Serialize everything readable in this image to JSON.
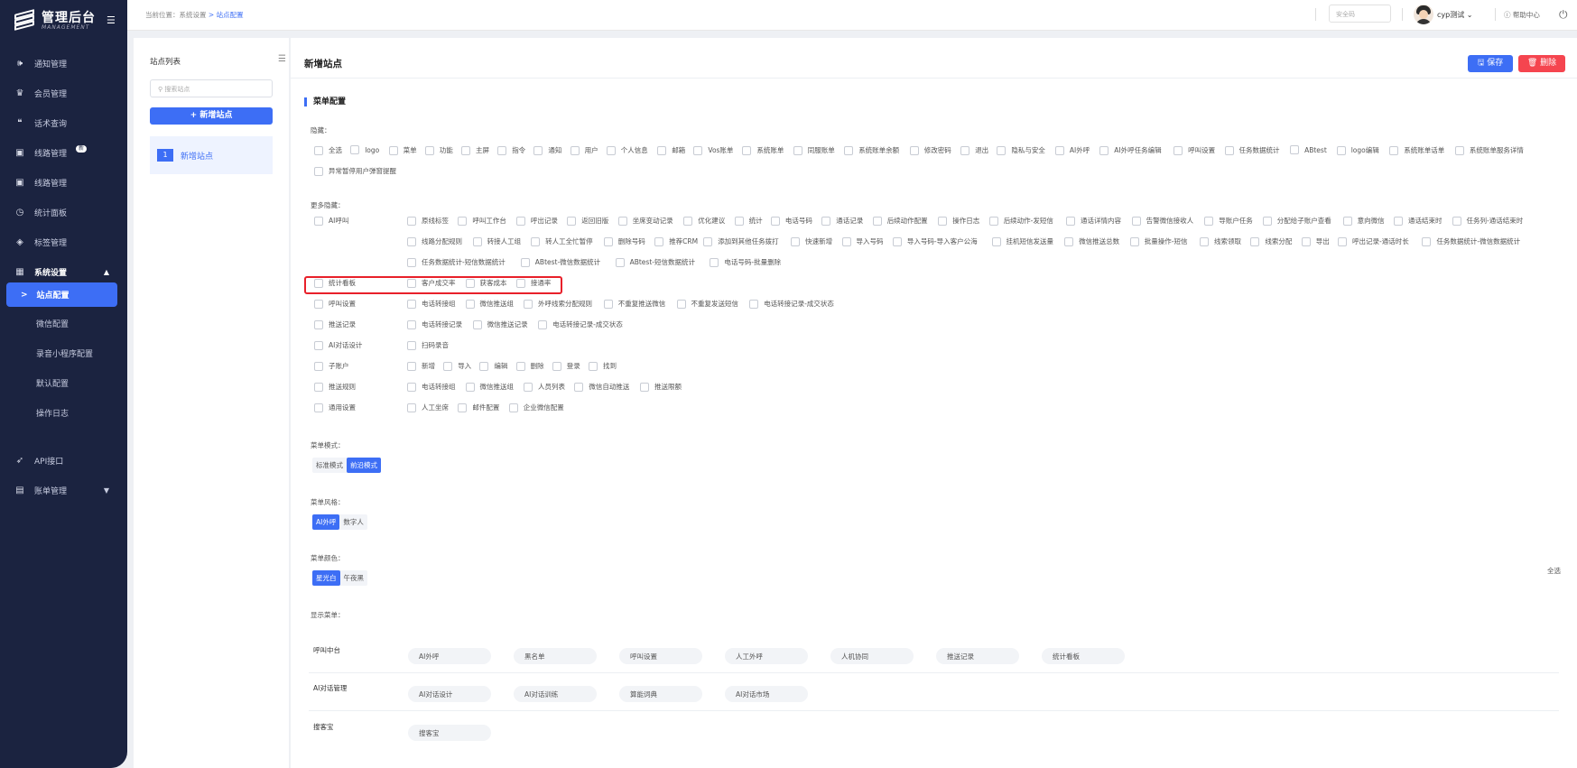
{
  "sidebar": {
    "logo_title": "管理后台",
    "logo_sub": "MANAGEMENT",
    "items": [
      {
        "label": "通知管理",
        "icon": "speaker-icon",
        "glyph": "🕪"
      },
      {
        "label": "会员管理",
        "icon": "crown-icon",
        "glyph": "♛"
      },
      {
        "label": "话术查询",
        "icon": "quote-icon",
        "glyph": "❝"
      },
      {
        "label": "线路管理",
        "icon": "image-icon",
        "glyph": "▣",
        "badge": "新"
      },
      {
        "label": "线路管理",
        "icon": "image-icon",
        "glyph": "▣"
      },
      {
        "label": "统计面板",
        "icon": "clock-icon",
        "glyph": "◷"
      },
      {
        "label": "标签管理",
        "icon": "tag-icon",
        "glyph": "◈"
      },
      {
        "label": "系统设置",
        "icon": "grid-icon",
        "glyph": "▦",
        "arrow": "▲"
      },
      {
        "label": "API接口",
        "icon": "rocket-icon",
        "glyph": "➶"
      },
      {
        "label": "账单管理",
        "icon": "book-icon",
        "glyph": "▤",
        "arrow": "▼"
      }
    ],
    "sub_items": [
      {
        "label": "站点配置",
        "glyph": ">"
      },
      {
        "label": "微信配置"
      },
      {
        "label": "录音小程序配置"
      },
      {
        "label": "默认配置"
      },
      {
        "label": "操作日志"
      }
    ]
  },
  "topbar": {
    "crumb_prefix": "当前位置：",
    "crumb_1": "系统设置",
    "crumb_sep": ">",
    "crumb_2": "站点配置",
    "security_placeholder": "安全码",
    "user": "cyp测试 ⌄",
    "help": "ⓘ 帮助中心",
    "power": "⏻"
  },
  "site_list": {
    "title": "站点列表",
    "search_placeholder": "搜索站点",
    "add_label": "+ 新增站点",
    "item_num": "1",
    "item_label": "新增站点"
  },
  "main": {
    "title": "新增站点",
    "save": "🖫 保存",
    "delete": "🗑 删除",
    "section": "菜单配置",
    "hide_label": "隐藏：",
    "hide_items": [
      "全选",
      "logo",
      "菜单",
      "功能",
      "主屏",
      "指令",
      "通知",
      "用户",
      "个人信息",
      "邮箱",
      "Vos账单",
      "系统账单",
      "同服账单",
      "系统账单余额",
      "修改密码",
      "退出",
      "隐私与安全",
      "AI外呼",
      "AI外呼任务编辑",
      "呼叫设置",
      "任务数据统计",
      "ABtest",
      "logo编辑",
      "系统账单话单",
      "系统账单服务详情",
      "异常暂停用户弹窗提醒"
    ],
    "more_label": "更多隐藏：",
    "more_rows": [
      {
        "name": "AI呼叫",
        "lines": [
          [
            "原线标签",
            "呼叫工作台",
            "呼出记录",
            "返回旧版",
            "坐席变动记录",
            "优化建议",
            "统计",
            "电话号码",
            "通话记录",
            "后续动作配置",
            "操作日志",
            "后续动作-发短信",
            "通话详情内容",
            "告警微信接收人",
            "导账户任务",
            "分配给子账户查看",
            "意向微信",
            "通话结束时",
            "任务列-通话结束时"
          ],
          [
            "线路分配规则",
            "转接人工组",
            "转人工全忙暂停",
            "删除号码",
            "推荐CRM",
            "添加到其他任务拨打",
            "快速新增",
            "导入号码",
            "导入号码-导入客户公海",
            "挂机短信发送量",
            "微信推送总数",
            "批量操作-短信",
            "线索领取",
            "线索分配",
            "导出",
            "呼出记录-通话时长",
            "任务数据统计-微信数据统计"
          ],
          [
            "任务数据统计-短信数据统计",
            "ABtest-微信数据统计",
            "ABtest-短信数据统计",
            "电话号码-批量删除"
          ]
        ]
      },
      {
        "name": "统计看板",
        "lines": [
          [
            "客户成交率",
            "获客成本",
            "接通率"
          ]
        ]
      },
      {
        "name": "呼叫设置",
        "lines": [
          [
            "电话转接组",
            "微信推送组",
            "外呼线索分配规则",
            "不重复推送微信",
            "不重复发送短信",
            "电话转接记录-成交状态"
          ]
        ]
      },
      {
        "name": "推送记录",
        "lines": [
          [
            "电话转接记录",
            "微信推送记录",
            "电话转接记录-成交状态"
          ]
        ]
      },
      {
        "name": "AI对话设计",
        "lines": [
          [
            "扫码录音"
          ]
        ]
      },
      {
        "name": "子账户",
        "lines": [
          [
            "新增",
            "导入",
            "编辑",
            "删除",
            "登录",
            "找到"
          ]
        ]
      },
      {
        "name": "推送规则",
        "lines": [
          [
            "电话转接组",
            "微信推送组",
            "人员列表",
            "微信自动推送",
            "推送限额"
          ]
        ]
      },
      {
        "name": "通用设置",
        "lines": [
          [
            "人工坐席",
            "邮件配置",
            "企业微信配置"
          ]
        ]
      }
    ],
    "mode_label": "菜单模式：",
    "mode_opts": [
      "标准模式",
      "前沿模式"
    ],
    "style_label": "菜单风格：",
    "style_opts": [
      "AI外呼",
      "数字人"
    ],
    "color_label": "菜单颜色：",
    "color_opts": [
      "星光白",
      "午夜黑"
    ],
    "show_label": "显示菜单：",
    "select_all": "全选",
    "show_rows": [
      {
        "name": "呼叫中台",
        "items": [
          "AI外呼",
          "黑名单",
          "呼叫设置",
          "人工外呼",
          "人机协同",
          "推送记录",
          "统计看板"
        ]
      },
      {
        "name": "AI对话管理",
        "items": [
          "AI对话设计",
          "AI对话训练",
          "算能词典",
          "AI对话市场"
        ]
      },
      {
        "name": "搜客宝",
        "items": [
          "搜客宝"
        ]
      }
    ]
  }
}
